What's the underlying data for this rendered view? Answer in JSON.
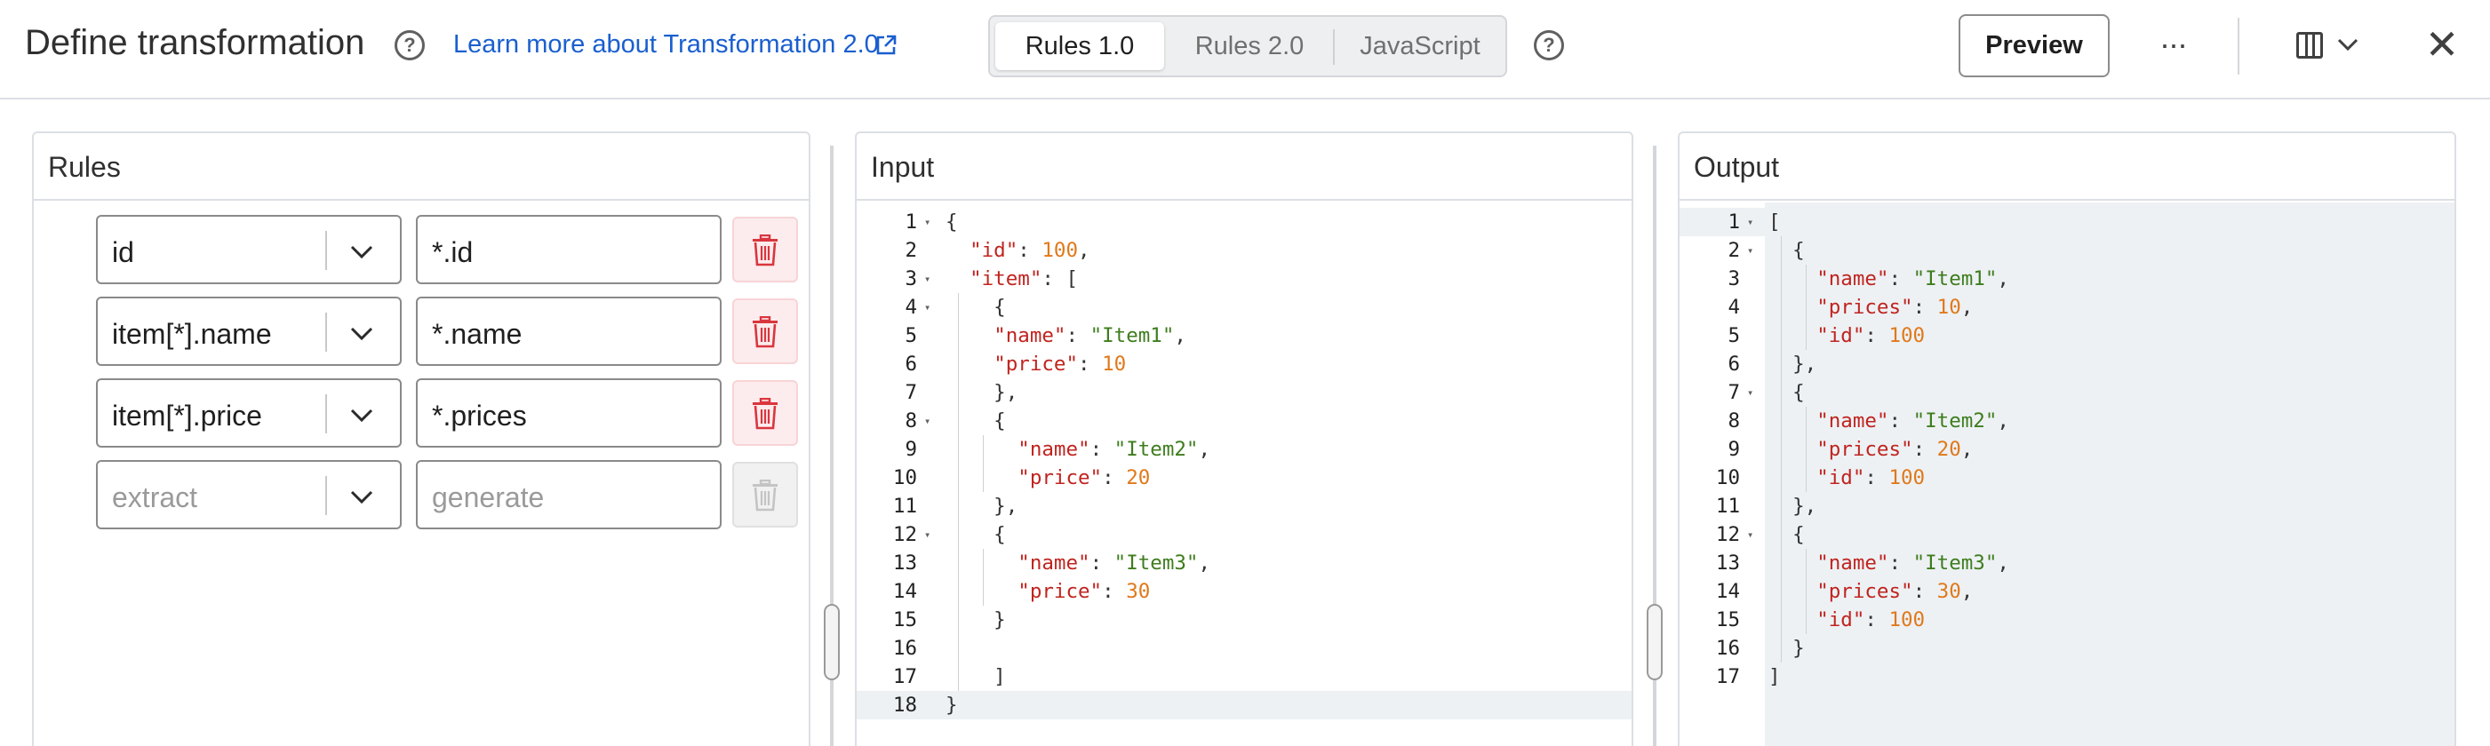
{
  "header": {
    "title": "Define transformation",
    "learn_link": "Learn more about Transformation 2.0",
    "help_glyph": "?",
    "tabs": [
      {
        "label": "Rules 1.0",
        "active": true
      },
      {
        "label": "Rules 2.0",
        "active": false
      },
      {
        "label": "JavaScript",
        "active": false
      }
    ],
    "preview_label": "Preview",
    "more_glyph": "···",
    "close_glyph": "✕"
  },
  "rules_panel": {
    "title": "Rules",
    "rows": [
      {
        "extract": "id",
        "generate": "*.id",
        "placeholder": false
      },
      {
        "extract": "item[*].name",
        "generate": "*.name",
        "placeholder": false
      },
      {
        "extract": "item[*].price",
        "generate": "*.prices",
        "placeholder": false
      },
      {
        "extract": "extract",
        "generate": "generate",
        "placeholder": true
      }
    ]
  },
  "input_panel": {
    "title": "Input",
    "lines": [
      [
        [
          "p",
          "{"
        ]
      ],
      [
        [
          "p",
          "  "
        ],
        [
          "k",
          "\"id\""
        ],
        [
          "p",
          ": "
        ],
        [
          "n",
          "100"
        ],
        [
          "p",
          ","
        ]
      ],
      [
        [
          "p",
          "  "
        ],
        [
          "k",
          "\"item\""
        ],
        [
          "p",
          ": ["
        ]
      ],
      [
        [
          "p",
          "    {"
        ]
      ],
      [
        [
          "p",
          "    "
        ],
        [
          "k",
          "\"name\""
        ],
        [
          "p",
          ": "
        ],
        [
          "s",
          "\"Item1\""
        ],
        [
          "p",
          ","
        ]
      ],
      [
        [
          "p",
          "    "
        ],
        [
          "k",
          "\"price\""
        ],
        [
          "p",
          ": "
        ],
        [
          "n",
          "10"
        ]
      ],
      [
        [
          "p",
          "    },"
        ]
      ],
      [
        [
          "p",
          "    {"
        ]
      ],
      [
        [
          "p",
          "      "
        ],
        [
          "k",
          "\"name\""
        ],
        [
          "p",
          ": "
        ],
        [
          "s",
          "\"Item2\""
        ],
        [
          "p",
          ","
        ]
      ],
      [
        [
          "p",
          "      "
        ],
        [
          "k",
          "\"price\""
        ],
        [
          "p",
          ": "
        ],
        [
          "n",
          "20"
        ]
      ],
      [
        [
          "p",
          "    },"
        ]
      ],
      [
        [
          "p",
          "    {"
        ]
      ],
      [
        [
          "p",
          "      "
        ],
        [
          "k",
          "\"name\""
        ],
        [
          "p",
          ": "
        ],
        [
          "s",
          "\"Item3\""
        ],
        [
          "p",
          ","
        ]
      ],
      [
        [
          "p",
          "      "
        ],
        [
          "k",
          "\"price\""
        ],
        [
          "p",
          ": "
        ],
        [
          "n",
          "30"
        ]
      ],
      [
        [
          "p",
          "    }"
        ]
      ],
      [
        [
          "p",
          ""
        ]
      ],
      [
        [
          "p",
          "    ]"
        ]
      ],
      [
        [
          "p",
          "}"
        ]
      ]
    ],
    "fold_lines": [
      1,
      3,
      4,
      8,
      12
    ]
  },
  "output_panel": {
    "title": "Output",
    "lines": [
      [
        [
          "p",
          "["
        ]
      ],
      [
        [
          "p",
          "  {"
        ]
      ],
      [
        [
          "p",
          "    "
        ],
        [
          "k",
          "\"name\""
        ],
        [
          "p",
          ": "
        ],
        [
          "s",
          "\"Item1\""
        ],
        [
          "p",
          ","
        ]
      ],
      [
        [
          "p",
          "    "
        ],
        [
          "k",
          "\"prices\""
        ],
        [
          "p",
          ": "
        ],
        [
          "n",
          "10"
        ],
        [
          "p",
          ","
        ]
      ],
      [
        [
          "p",
          "    "
        ],
        [
          "k",
          "\"id\""
        ],
        [
          "p",
          ": "
        ],
        [
          "n",
          "100"
        ]
      ],
      [
        [
          "p",
          "  },"
        ]
      ],
      [
        [
          "p",
          "  {"
        ]
      ],
      [
        [
          "p",
          "    "
        ],
        [
          "k",
          "\"name\""
        ],
        [
          "p",
          ": "
        ],
        [
          "s",
          "\"Item2\""
        ],
        [
          "p",
          ","
        ]
      ],
      [
        [
          "p",
          "    "
        ],
        [
          "k",
          "\"prices\""
        ],
        [
          "p",
          ": "
        ],
        [
          "n",
          "20"
        ],
        [
          "p",
          ","
        ]
      ],
      [
        [
          "p",
          "    "
        ],
        [
          "k",
          "\"id\""
        ],
        [
          "p",
          ": "
        ],
        [
          "n",
          "100"
        ]
      ],
      [
        [
          "p",
          "  },"
        ]
      ],
      [
        [
          "p",
          "  {"
        ]
      ],
      [
        [
          "p",
          "    "
        ],
        [
          "k",
          "\"name\""
        ],
        [
          "p",
          ": "
        ],
        [
          "s",
          "\"Item3\""
        ],
        [
          "p",
          ","
        ]
      ],
      [
        [
          "p",
          "    "
        ],
        [
          "k",
          "\"prices\""
        ],
        [
          "p",
          ": "
        ],
        [
          "n",
          "30"
        ],
        [
          "p",
          ","
        ]
      ],
      [
        [
          "p",
          "    "
        ],
        [
          "k",
          "\"id\""
        ],
        [
          "p",
          ": "
        ],
        [
          "n",
          "100"
        ]
      ],
      [
        [
          "p",
          "  }"
        ]
      ],
      [
        [
          "p",
          "]"
        ]
      ]
    ],
    "fold_lines": [
      1,
      2,
      7,
      12
    ]
  },
  "colors": {
    "link": "#1a5fcf",
    "key": "#c0241f",
    "string": "#3e7d1d",
    "number": "#e0791b",
    "delete_icon": "#d9363e"
  }
}
